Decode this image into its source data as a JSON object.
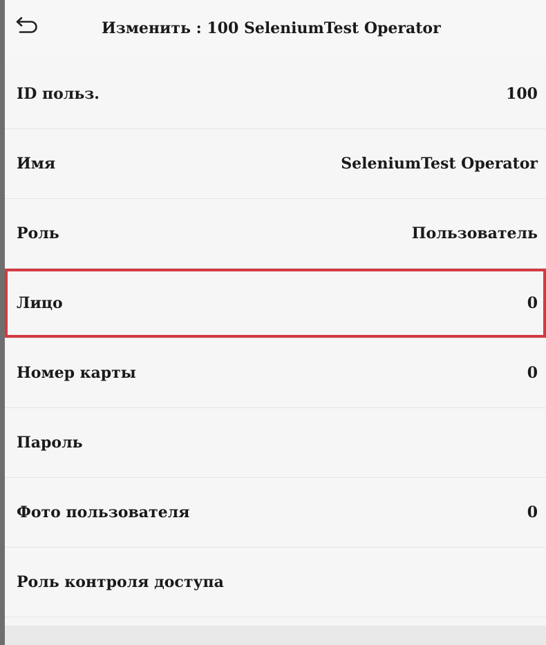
{
  "header": {
    "back_icon": "return-arrow-icon",
    "title": "Изменить : 100 SeleniumTest Operator"
  },
  "fields": [
    {
      "label": "ID польз.",
      "value": "100"
    },
    {
      "label": "Имя",
      "value": "SeleniumTest Operator"
    },
    {
      "label": "Роль",
      "value": "Пользователь"
    },
    {
      "label": "Лицо",
      "value": "0"
    },
    {
      "label": "Номер карты",
      "value": "0"
    },
    {
      "label": "Пароль",
      "value": ""
    },
    {
      "label": "Фото пользователя",
      "value": "0"
    },
    {
      "label": "Роль контроля доступа",
      "value": ""
    }
  ],
  "highlight_color": "#d33a41"
}
